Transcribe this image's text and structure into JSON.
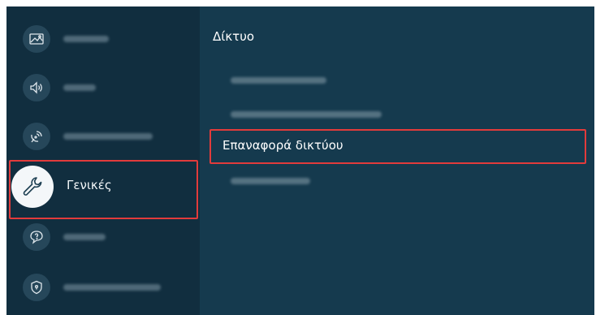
{
  "panel": {
    "title": "Δίκτυο",
    "selected_option": "Επαναφορά δικτύου"
  },
  "sidebar": {
    "selected_label": "Γενικές"
  },
  "colors": {
    "sidebar_bg": "#112e3f",
    "panel_bg": "#153a4e",
    "highlight": "#e23b3b"
  },
  "icons": [
    "picture-icon",
    "sound-icon",
    "broadcasting-icon",
    "wrench-icon",
    "support-icon",
    "privacy-shield-icon"
  ]
}
